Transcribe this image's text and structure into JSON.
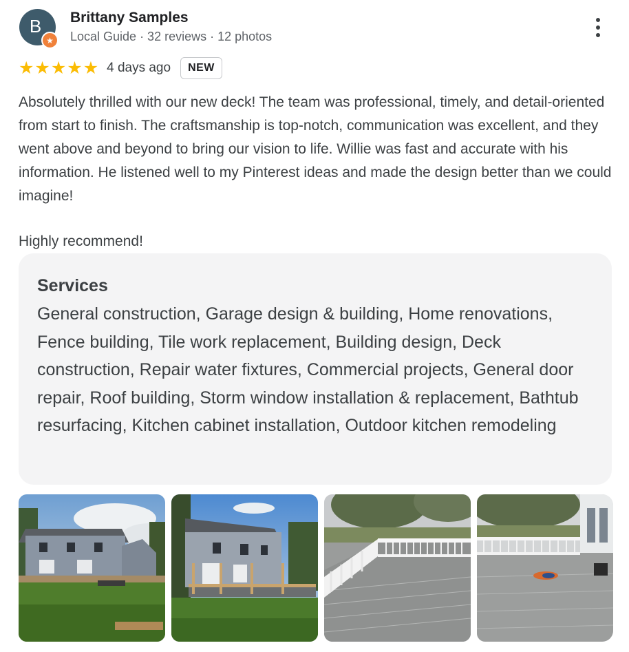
{
  "reviewer": {
    "name": "Brittany Samples",
    "avatar_letter": "B",
    "meta": "Local Guide · 32 reviews · 12 photos",
    "badge_icon": "star-badge-icon"
  },
  "rating": {
    "stars": 5,
    "star_glyph": "★",
    "star_color": "#fbbc04",
    "age": "4 days ago",
    "badge": "NEW"
  },
  "review": {
    "text": "Absolutely thrilled with our new deck! The team was professional, timely, and detail-oriented from start to finish. The craftsmanship is top-notch, communication was excellent, and they went above and beyond to bring our vision to life. Willie was fast and accurate with his information. He listened well to my Pinterest ideas and made the design better than we could imagine!",
    "closing": "Highly recommend!"
  },
  "services": {
    "title": "Services",
    "text": "General construction, Garage design & building, Home renovations, Fence building, Tile work replacement, Building design, Deck construction, Repair water fixtures, Commercial projects, General door repair, Roof building, Storm window installation & replacement, Bathtub resurfacing, Kitchen cabinet installation, Outdoor kitchen remodeling"
  },
  "photos": [
    {
      "subject": "house-back-with-deck-frame-photo"
    },
    {
      "subject": "house-side-with-deck-frame-photo"
    },
    {
      "subject": "finished-deck-railing-photo"
    },
    {
      "subject": "finished-deck-wide-photo"
    }
  ],
  "menu_icon": "more-vert-icon"
}
